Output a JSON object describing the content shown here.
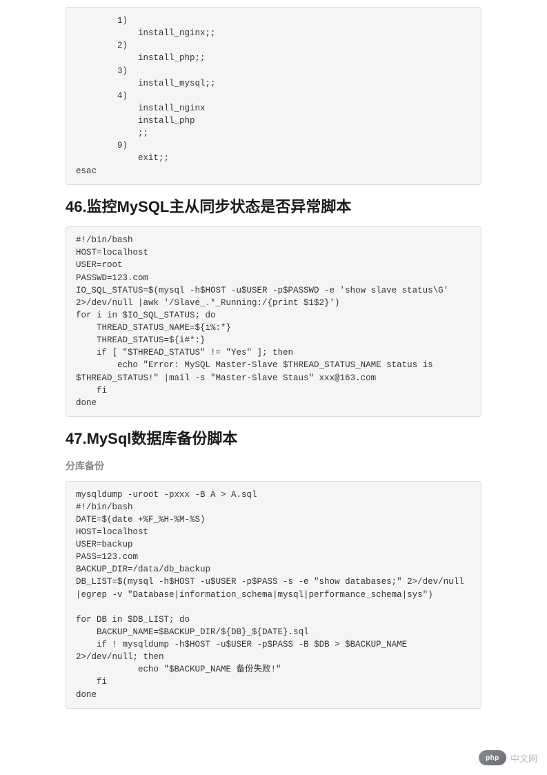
{
  "code1": "        1)\n            install_nginx;;\n        2)\n            install_php;;\n        3)\n            install_mysql;;\n        4)\n            install_nginx\n            install_php\n            ;;\n        9)\n            exit;;\nesac",
  "heading46": "46.监控MySQL主从同步状态是否异常脚本",
  "code2": "#!/bin/bash\nHOST=localhost\nUSER=root\nPASSWD=123.com\nIO_SQL_STATUS=$(mysql -h$HOST -u$USER -p$PASSWD -e 'show slave status\\G' 2>/dev/null |awk '/Slave_.*_Running:/{print $1$2}')\nfor i in $IO_SQL_STATUS; do\n    THREAD_STATUS_NAME=${i%:*}\n    THREAD_STATUS=${i#*:}\n    if [ \"$THREAD_STATUS\" != \"Yes\" ]; then\n        echo \"Error: MySQL Master-Slave $THREAD_STATUS_NAME status is $THREAD_STATUS!\" |mail -s \"Master-Slave Staus\" xxx@163.com\n    fi\ndone",
  "heading47": "47.MySql数据库备份脚本",
  "sublabel47": "分库备份",
  "code3": "mysqldump -uroot -pxxx -B A > A.sql\n#!/bin/bash\nDATE=$(date +%F_%H-%M-%S)\nHOST=localhost\nUSER=backup\nPASS=123.com\nBACKUP_DIR=/data/db_backup\nDB_LIST=$(mysql -h$HOST -u$USER -p$PASS -s -e \"show databases;\" 2>/dev/null |egrep -v \"Database|information_schema|mysql|performance_schema|sys\")\n\nfor DB in $DB_LIST; do\n    BACKUP_NAME=$BACKUP_DIR/${DB}_${DATE}.sql\n    if ! mysqldump -h$HOST -u$USER -p$PASS -B $DB > $BACKUP_NAME 2>/dev/null; then\n            echo \"$BACKUP_NAME 备份失败!\"\n    fi\ndone",
  "watermark": {
    "logo": "php",
    "text": "中文网"
  }
}
